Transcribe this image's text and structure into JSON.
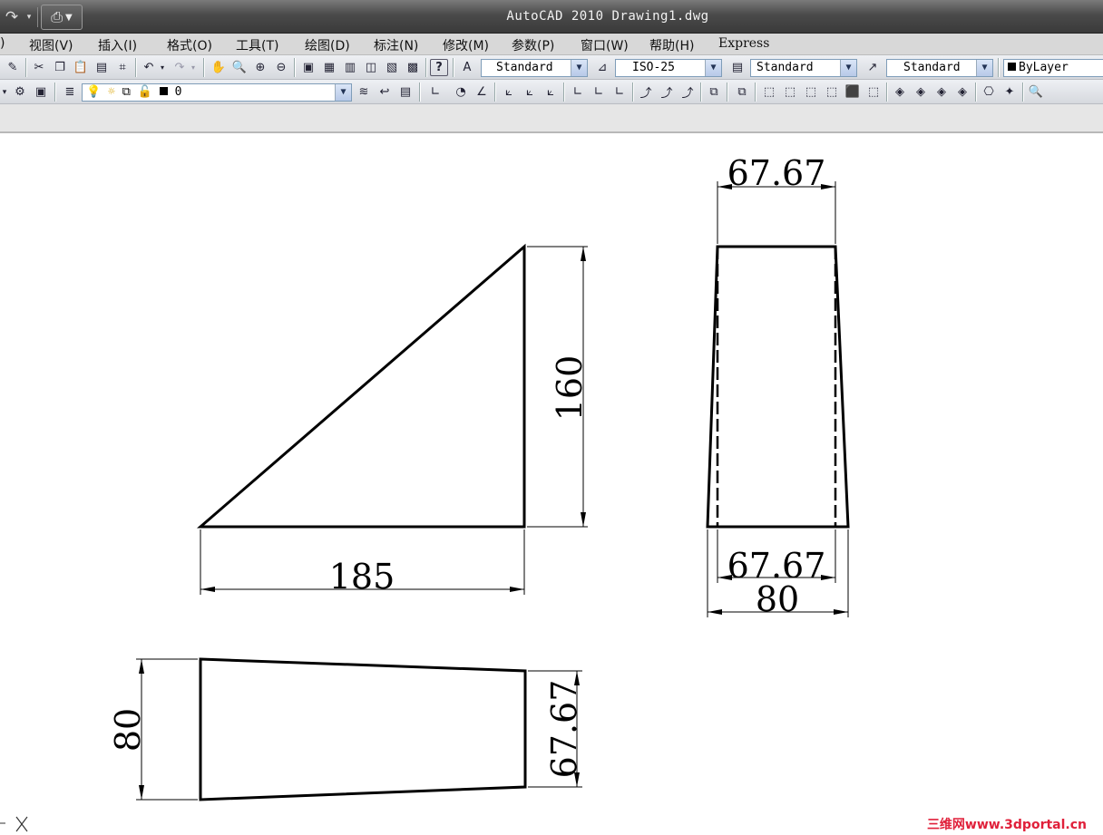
{
  "app": {
    "title": "AutoCAD 2010  Drawing1.dwg"
  },
  "quick_access": {
    "redo_icon": "redo-icon",
    "print_icon": "print-icon"
  },
  "menu": {
    "items": [
      {
        "label": ")"
      },
      {
        "label": "视图(V)"
      },
      {
        "label": "插入(I)"
      },
      {
        "label": "格式(O)"
      },
      {
        "label": "工具(T)"
      },
      {
        "label": "绘图(D)"
      },
      {
        "label": "标注(N)"
      },
      {
        "label": "修改(M)"
      },
      {
        "label": "参数(P)"
      },
      {
        "label": "窗口(W)"
      },
      {
        "label": "帮助(H)"
      },
      {
        "label": "Express"
      }
    ]
  },
  "styles_toolbar": {
    "text_style": "Standard",
    "dim_style": "ISO-25",
    "table_style": "Standard",
    "multileader_style": "Standard",
    "color": "ByLayer"
  },
  "layers_toolbar": {
    "current_layer": "0"
  },
  "drawing": {
    "front_view": {
      "width_dim": "185",
      "height_dim": "160"
    },
    "side_view": {
      "top_dim": "67.67",
      "inner_bottom_dim": "67.67",
      "outer_bottom_dim": "80"
    },
    "top_view": {
      "left_dim": "80",
      "right_dim": "67.67"
    }
  },
  "watermark": "三维网www.3dportal.cn",
  "colors": {
    "title_bar": "#4a4a4a",
    "menu_bar": "#d8d8d8",
    "canvas": "#ffffff",
    "watermark": "#e0203a"
  }
}
